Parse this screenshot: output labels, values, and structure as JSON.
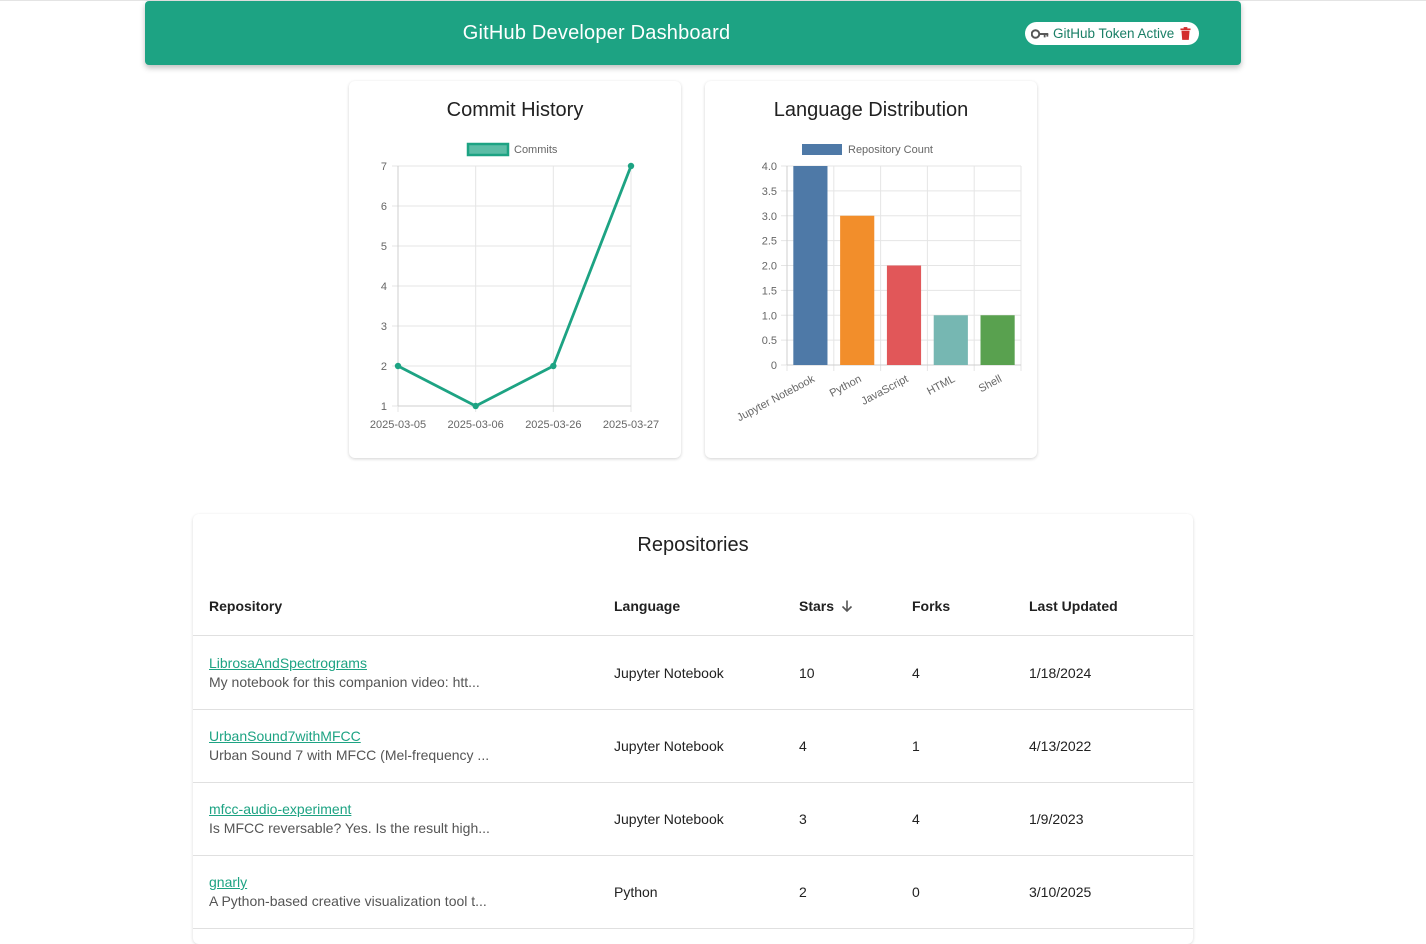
{
  "header": {
    "title": "GitHub Developer Dashboard",
    "token_label": "GitHub Token Active"
  },
  "colors": {
    "primary": "#1da383",
    "delete": "#d32f2f"
  },
  "commit_card": {
    "title": "Commit History"
  },
  "language_card": {
    "title": "Language Distribution"
  },
  "chart_data": [
    {
      "type": "line",
      "title": "Commit History",
      "x": [
        "2025-03-05",
        "2025-03-06",
        "2025-03-26",
        "2025-03-27"
      ],
      "series": [
        {
          "name": "Commits",
          "values": [
            2,
            1,
            2,
            7
          ],
          "color": "#1da383"
        }
      ],
      "ylim": [
        1,
        7
      ],
      "yticks": [
        1,
        2,
        3,
        4,
        5,
        6,
        7
      ],
      "grid": true,
      "legend": "top"
    },
    {
      "type": "bar",
      "title": "Language Distribution",
      "categories": [
        "Jupyter Notebook",
        "Python",
        "JavaScript",
        "HTML",
        "Shell"
      ],
      "series": [
        {
          "name": "Repository Count",
          "values": [
            4,
            3,
            2,
            1,
            1
          ]
        }
      ],
      "colors": [
        "#4e79a7",
        "#f28e2b",
        "#e15759",
        "#76b7b2",
        "#59a14f"
      ],
      "legend_color": "#4e79a7",
      "ylim": [
        0,
        4
      ],
      "yticks": [
        "0",
        "0.5",
        "1.0",
        "1.5",
        "2.0",
        "2.5",
        "3.0",
        "3.5",
        "4.0"
      ],
      "grid": true,
      "legend": "top"
    }
  ],
  "repositories": {
    "title": "Repositories",
    "columns": {
      "repository": "Repository",
      "language": "Language",
      "stars": "Stars",
      "forks": "Forks",
      "updated": "Last Updated"
    },
    "rows": [
      {
        "name": "LibrosaAndSpectrograms",
        "description": "My notebook for this companion video: htt...",
        "language": "Jupyter Notebook",
        "stars": "10",
        "forks": "4",
        "updated": "1/18/2024"
      },
      {
        "name": "UrbanSound7withMFCC",
        "description": "Urban Sound 7 with MFCC (Mel-frequency ...",
        "language": "Jupyter Notebook",
        "stars": "4",
        "forks": "1",
        "updated": "4/13/2022"
      },
      {
        "name": "mfcc-audio-experiment",
        "description": "Is MFCC reversable? Yes. Is the result high...",
        "language": "Jupyter Notebook",
        "stars": "3",
        "forks": "4",
        "updated": "1/9/2023"
      },
      {
        "name": "gnarly",
        "description": "A Python-based creative visualization tool t...",
        "language": "Python",
        "stars": "2",
        "forks": "0",
        "updated": "3/10/2025"
      }
    ]
  }
}
